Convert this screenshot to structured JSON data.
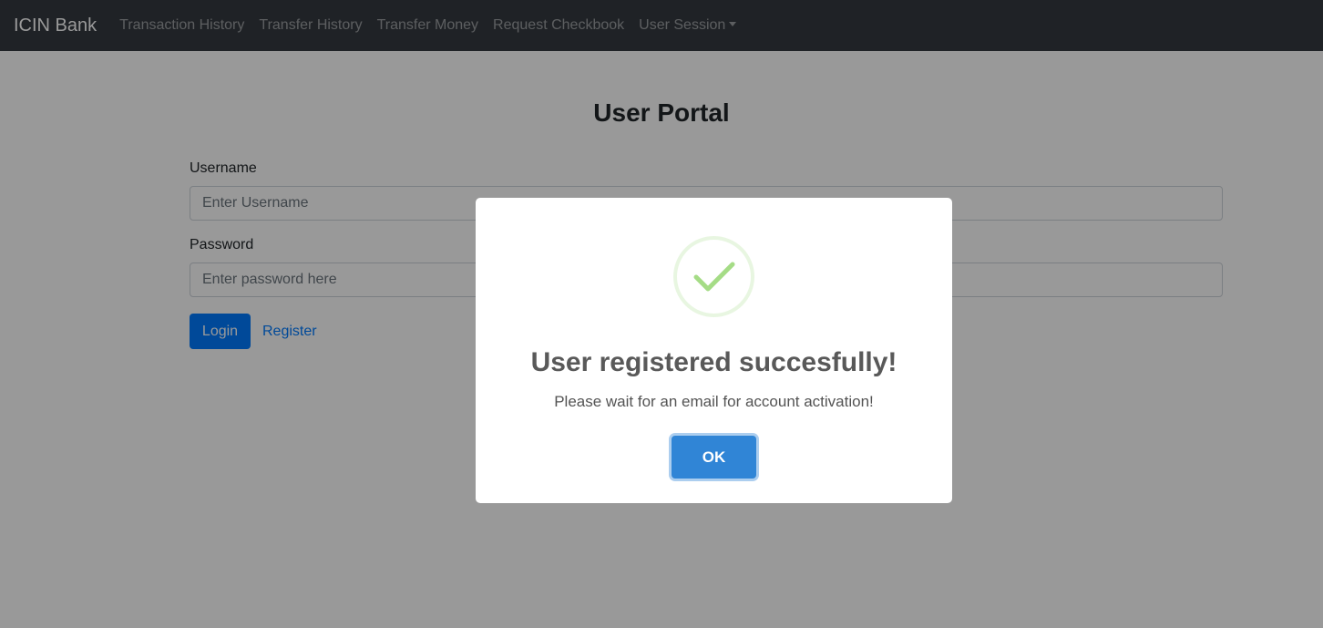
{
  "navbar": {
    "brand": "ICIN Bank",
    "links": [
      "Transaction History",
      "Transfer History",
      "Transfer Money",
      "Request Checkbook"
    ],
    "dropdown_label": "User Session"
  },
  "main": {
    "title": "User Portal",
    "username_label": "Username",
    "username_placeholder": "Enter Username",
    "password_label": "Password",
    "password_placeholder": "Enter password here",
    "login_label": "Login",
    "register_label": "Register"
  },
  "modal": {
    "icon": "success-check-icon",
    "title": "User registered succesfully!",
    "text": "Please wait for an email for account activation!",
    "ok_label": "OK"
  },
  "colors": {
    "navbar_bg": "#343a40",
    "primary": "#007bff",
    "success": "#a5dc86",
    "confirm": "#3085d6"
  }
}
